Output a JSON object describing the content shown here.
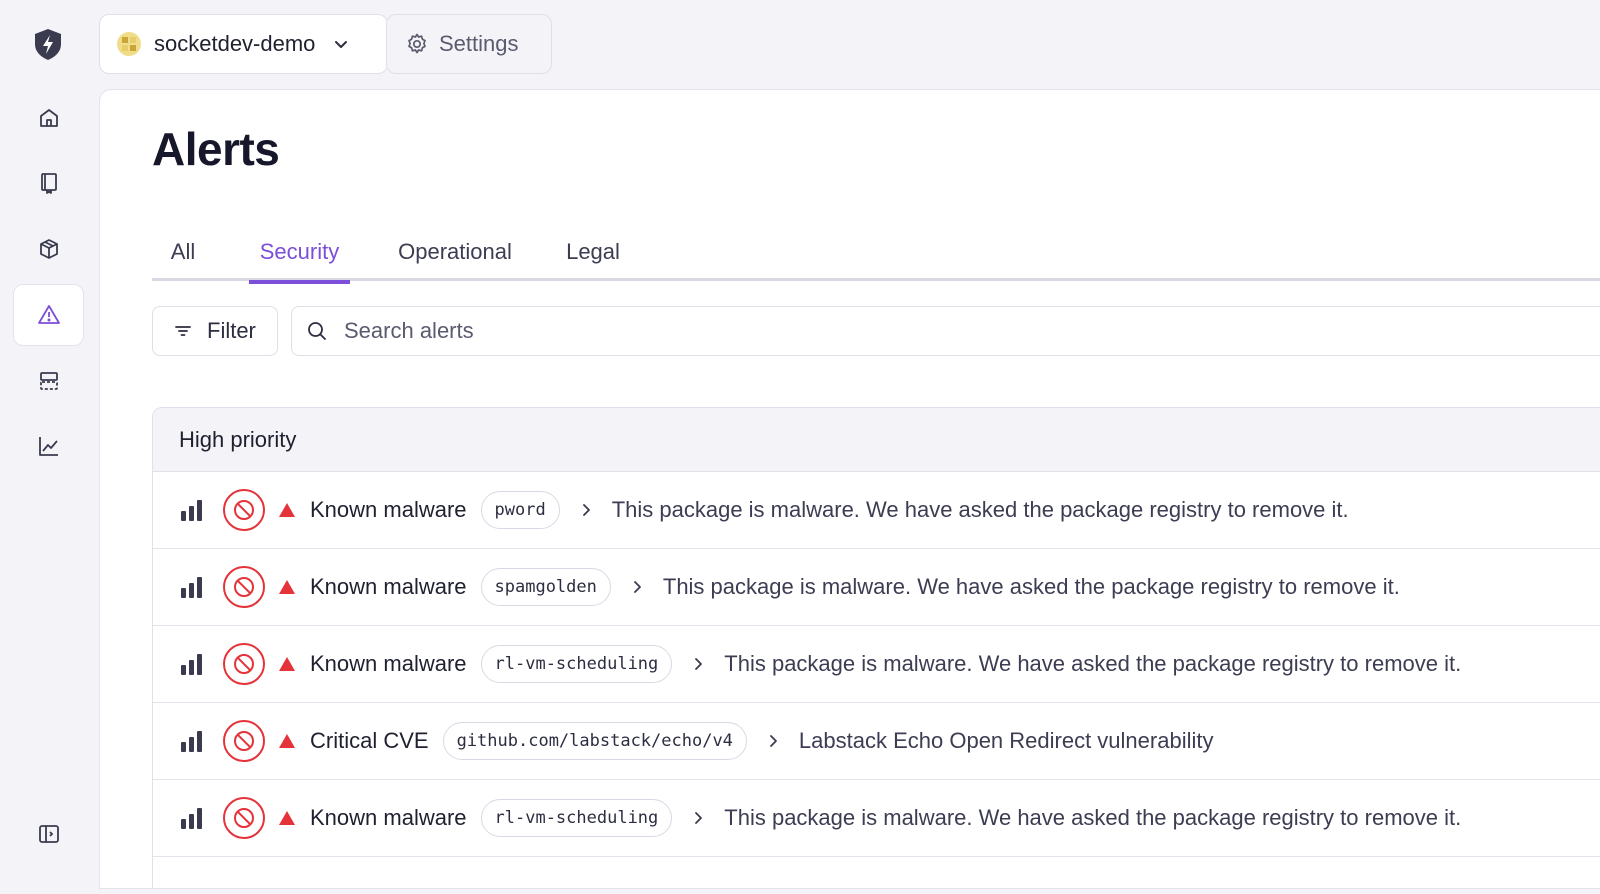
{
  "org": {
    "name": "socketdev-demo"
  },
  "top": {
    "settings_label": "Settings"
  },
  "sidebar": {
    "items": [
      {
        "icon": "home-icon"
      },
      {
        "icon": "repo-book-icon"
      },
      {
        "icon": "package-icon"
      },
      {
        "icon": "alert-triangle-icon",
        "active": true
      },
      {
        "icon": "stack-icon"
      },
      {
        "icon": "chart-icon"
      }
    ],
    "collapse_icon": "sidebar-toggle-icon"
  },
  "page": {
    "title": "Alerts"
  },
  "tabs": [
    {
      "label": "All"
    },
    {
      "label": "Security",
      "active": true
    },
    {
      "label": "Operational"
    },
    {
      "label": "Legal"
    }
  ],
  "toolbar": {
    "filter_label": "Filter",
    "search_placeholder": "Search alerts"
  },
  "group": {
    "title": "High priority"
  },
  "alerts": [
    {
      "type": "Known malware",
      "package": "pword",
      "description": "This package is malware. We have asked the package registry to remove it."
    },
    {
      "type": "Known malware",
      "package": "spamgolden",
      "description": "This package is malware. We have asked the package registry to remove it."
    },
    {
      "type": "Known malware",
      "package": "rl-vm-scheduling",
      "description": "This package is malware. We have asked the package registry to remove it."
    },
    {
      "type": "Critical CVE",
      "package": "github.com/labstack/echo/v4",
      "description": "Labstack Echo Open Redirect vulnerability"
    },
    {
      "type": "Known malware",
      "package": "rl-vm-scheduling",
      "description": "This package is malware. We have asked the package registry to remove it."
    }
  ],
  "colors": {
    "accent": "#7b4fd8",
    "critical": "#e5333a"
  }
}
